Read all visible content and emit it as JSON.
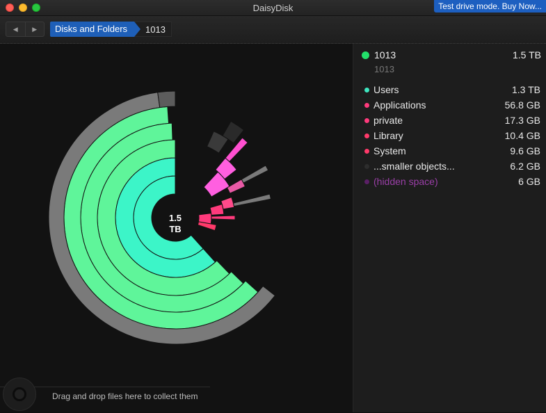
{
  "window": {
    "title": "DaisyDisk",
    "trial_banner": "Test drive mode. Buy Now..."
  },
  "toolbar": {
    "back_glyph": "◀",
    "forward_glyph": "▶",
    "breadcrumb_root": "Disks and Folders",
    "breadcrumb_current": "1013"
  },
  "chart": {
    "center_value": "1.5",
    "center_unit": "TB"
  },
  "collector": {
    "text": "Drag and drop files here to collect them"
  },
  "panel": {
    "root": {
      "name": "1013",
      "size": "1.5 TB",
      "subtitle": "1013",
      "color": "#22e06a"
    },
    "items": [
      {
        "name": "Users",
        "size": "1.3 TB",
        "color": "#3ee6c0"
      },
      {
        "name": "Applications",
        "size": "56.8 GB",
        "color": "#ff3a7c"
      },
      {
        "name": "private",
        "size": "17.3 GB",
        "color": "#ff3a7c"
      },
      {
        "name": "Library",
        "size": "10.4 GB",
        "color": "#ff3a6a"
      },
      {
        "name": "System",
        "size": "9.6 GB",
        "color": "#ff3a6a"
      },
      {
        "name": "...smaller objects...",
        "size": "6.2 GB",
        "color": "#2d2d2d"
      },
      {
        "name": "(hidden space)",
        "size": "6    GB",
        "color": "#5a1f66"
      }
    ]
  },
  "colors": {
    "users_teal": "#3cf5c8",
    "users_green": "#5ff59a",
    "outer_gray": "#7a7a7a",
    "magenta": "#ff5fe0",
    "pink": "#ff3a7c",
    "accent_blue": "#1e5fb8"
  }
}
